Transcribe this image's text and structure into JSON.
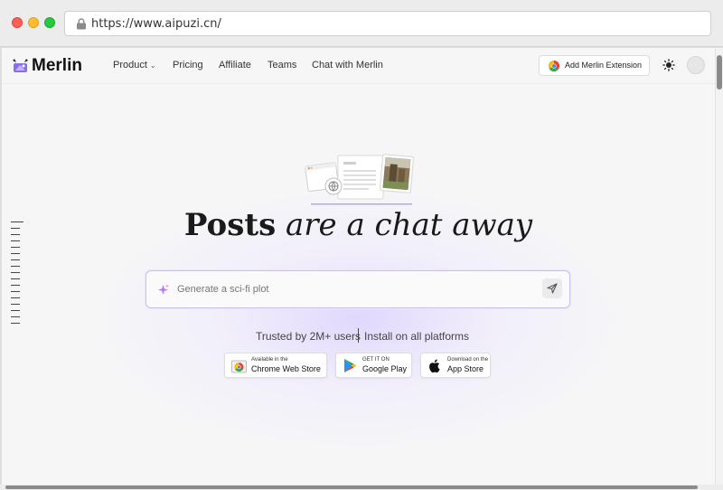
{
  "browser": {
    "url": "https://www.aipuzi.cn/"
  },
  "nav": {
    "brand": "Merlin",
    "links": [
      "Product",
      "Pricing",
      "Affiliate",
      "Teams",
      "Chat with Merlin"
    ],
    "product_chevron": "⌄",
    "extension_button": "Add Merlin Extension"
  },
  "hero": {
    "headline_bold": "Posts",
    "headline_italic": "are a chat away",
    "prompt_placeholder": "Generate a sci-fi plot",
    "trusted_text": "Trusted by 2M+ users",
    "install_text": "Install on all platforms"
  },
  "stores": [
    {
      "small": "Available in the",
      "big": "Chrome Web Store",
      "icon": "chrome-web-store-icon"
    },
    {
      "small": "GET IT ON",
      "big": "Google Play",
      "icon": "google-play-icon"
    },
    {
      "small": "Download on the",
      "big": "App Store",
      "icon": "apple-icon"
    }
  ],
  "colors": {
    "accent_purple": "#cdbff0",
    "glow": "#dacefe",
    "page_bg": "#f6f6f7"
  }
}
